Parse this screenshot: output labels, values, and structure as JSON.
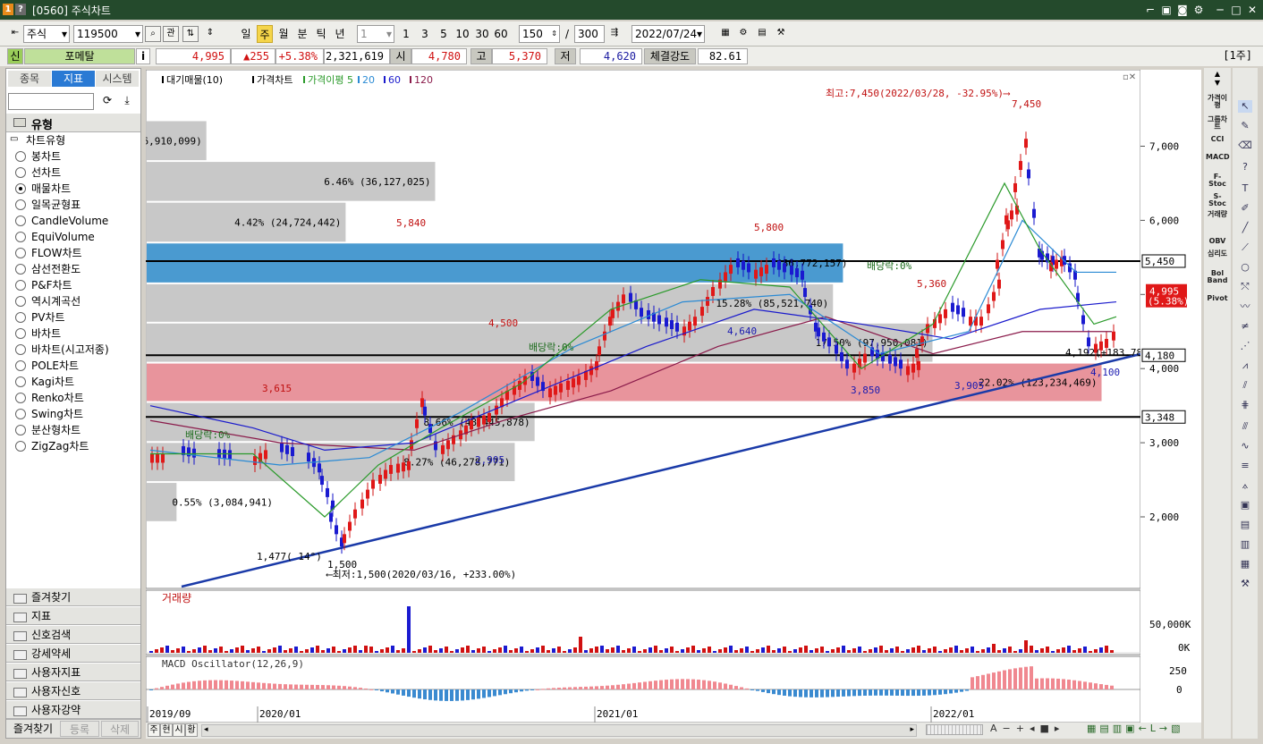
{
  "window": {
    "badge1": "1",
    "badge2": "?",
    "title": "[0560] 주식차트"
  },
  "toolbar": {
    "market": "주식",
    "code": "119500",
    "btn_gwan": "관",
    "periods": [
      "일",
      "주",
      "월",
      "분",
      "틱",
      "년"
    ],
    "interval_value": "1",
    "interval_presets": [
      "1",
      "3",
      "5",
      "10",
      "30",
      "60"
    ],
    "count_value": "150",
    "slash": "/",
    "count_total": "300",
    "date": "2022/07/24"
  },
  "infobar": {
    "badge": "신",
    "stock_name": "포메탈",
    "info_btn": "i",
    "price": "4,995",
    "change": "▲255",
    "change_pct": "+5.38%",
    "volume": "2,321,619",
    "open_label": "시",
    "open": "4,780",
    "high_label": "고",
    "high": "5,370",
    "low_label": "저",
    "low": "4,620",
    "strength_label": "체결강도",
    "strength": "82.61",
    "period_tag": "[1주]"
  },
  "left_panel": {
    "tabs": [
      "종목",
      "지표",
      "시스템"
    ],
    "active_tab": "지표",
    "section_title": "유형",
    "tree_root": "차트유형",
    "chart_types": [
      "봉차트",
      "선차트",
      "매물차트",
      "일목균형표",
      "CandleVolume",
      "EquiVolume",
      "FLOW차트",
      "삼선전환도",
      "P&F차트",
      "역시계곡선",
      "PV차트",
      "바차트",
      "바차트(시고저종)",
      "POLE차트",
      "Kagi차트",
      "Renko차트",
      "Swing차트",
      "분산형차트",
      "ZigZag차트"
    ],
    "selected_type": "매물차트",
    "folders": [
      "즐겨찾기",
      "지표",
      "신호검색",
      "강세약세",
      "사용자지표",
      "사용자신호",
      "사용자강약"
    ],
    "bottom_tabs": [
      "즐겨찾기",
      "등록",
      "삭제"
    ]
  },
  "chart": {
    "legend": [
      "대기매물(10)",
      "가격차트",
      "가격이평 5",
      "20",
      "60",
      "120"
    ],
    "legend_colors": [
      "#000000",
      "#000000",
      "#2a9a2a",
      "#2a8ad4",
      "#1a1acc",
      "#8a1a4a"
    ],
    "volume_bands": [
      {
        "label": "1.23% (6,910,099)",
        "price_from": 6800,
        "price_to": 7350,
        "width_frac": 0.06
      },
      {
        "label": "6.46% (36,127,025)",
        "price_from": 6250,
        "price_to": 6800,
        "width_frac": 0.29
      },
      {
        "label": "4.42% (24,724,442)",
        "price_from": 5700,
        "price_to": 6250,
        "width_frac": 0.2
      },
      {
        "label": "(86,772,157)",
        "price_from": 5150,
        "price_to": 5700,
        "width_frac": 0.7,
        "highlight": "blue"
      },
      {
        "label": "15.28% (85,521,740)",
        "price_from": 4620,
        "price_to": 5150,
        "width_frac": 0.69
      },
      {
        "label": "17.50% (97,950,081)",
        "price_from": 4080,
        "price_to": 4620,
        "width_frac": 0.79
      },
      {
        "label": "22.02% (123,234,469)",
        "price_from": 3550,
        "price_to": 4080,
        "width_frac": 0.96,
        "highlight": "red"
      },
      {
        "label": "8.66% (48,445,878)",
        "price_from": 3010,
        "price_to": 3550,
        "width_frac": 0.39
      },
      {
        "label": "8.27% (46,278,771)",
        "price_from": 2470,
        "price_to": 3010,
        "width_frac": 0.37
      },
      {
        "label": "0.55% (3,084,941)",
        "price_from": 1930,
        "price_to": 2470,
        "width_frac": 0.03
      }
    ],
    "hlines": [
      5450,
      4180,
      3348
    ],
    "annotations": {
      "max": "최고:7,450(2022/03/28, -32.95%)⟶",
      "min": "⟵최저:1,500(2020/03/16, +233.00%)",
      "angle": "1,477( 14°)",
      "trend": "4,192(+183.78 %)",
      "div1": "배당락:0%",
      "div2": "배당락:0%",
      "div3": "배당락:0%"
    },
    "peak_labels": [
      "5,840",
      "4,500",
      "5,800",
      "5,360",
      "7,450",
      "3,615",
      "2,905",
      "1,500",
      "4,640",
      "3,850",
      "3,905",
      "4,100"
    ],
    "y_ticks": [
      "7,000",
      "6,000",
      "5,000",
      "4,000",
      "3,000",
      "2,000"
    ],
    "tags": {
      "t1": "5,450",
      "t2": "4,180",
      "t3": "3,348",
      "price": "4,995",
      "price_pct": "(5.38%)"
    },
    "volume_title": "거래량",
    "volume_ticks": [
      "50,000K",
      "0K"
    ],
    "macd_title": "MACD Oscillator(12,26,9)",
    "macd_ticks": [
      "250",
      "0"
    ],
    "x_labels": [
      "2019/09",
      "2020/01",
      "2021/01",
      "2022/01"
    ],
    "bottom_tabs": [
      "주",
      "현",
      "시",
      "황"
    ]
  },
  "right_tools": [
    "가격이평",
    "그룹차트",
    "CCI",
    "MACD",
    "F-Stoc",
    "S-Stoc",
    "거래량",
    "OBV",
    "심리도",
    "Bol Band",
    "Pivot"
  ]
}
